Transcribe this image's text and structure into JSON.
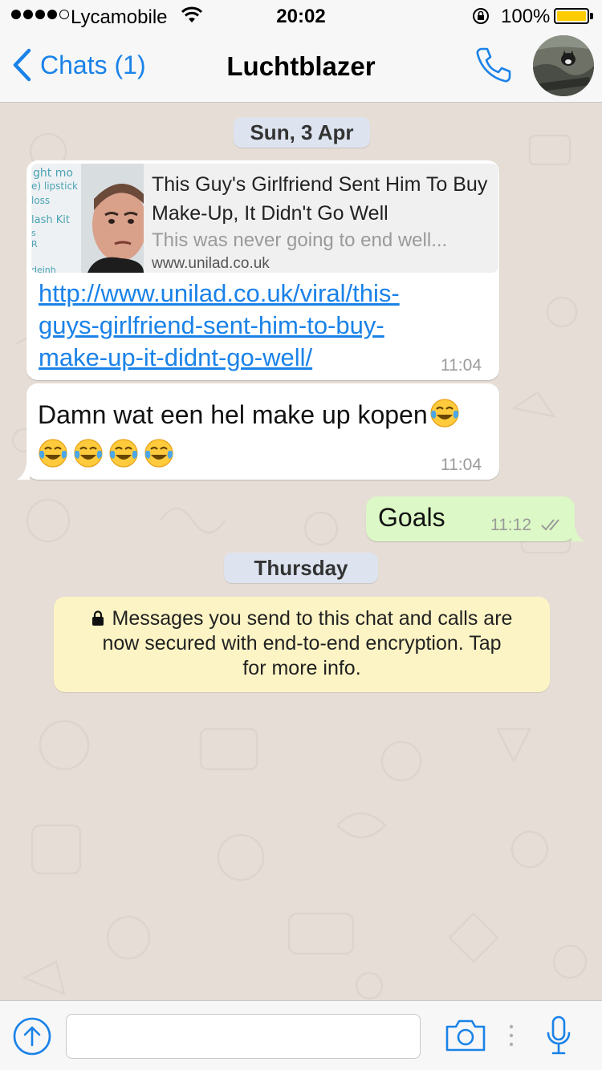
{
  "status_bar": {
    "carrier": "Lycamobile",
    "time": "20:02",
    "battery": "100%"
  },
  "nav": {
    "back_label": "Chats (1)",
    "title": "Luchtblazer"
  },
  "chat": {
    "date_1": "Sun, 3 Apr",
    "link_message": {
      "preview_title": "This Guy's Girlfriend Sent Him To Buy Make-Up, It Didn't Go Well",
      "preview_description": "This was never going to end well...",
      "preview_domain": "www.unilad.co.uk",
      "thumb_text": [
        "ght mo",
        "e) lipstick",
        "loss",
        "lash Kit",
        "s",
        "R",
        "deinh"
      ],
      "link_lines": [
        "http://www.unilad.co.uk/viral/this-",
        "guys-girlfriend-sent-him-to-buy-",
        "make-up-it-didnt-go-well/"
      ],
      "time": "11:04"
    },
    "text_message": {
      "text": "Damn wat een hel make up kopen",
      "time": "11:04"
    },
    "outgoing_message": {
      "text": "Goals",
      "time": "11:12"
    },
    "date_2": "Thursday",
    "encryption_notice": [
      "Messages you send to this chat and calls are",
      "now secured with end-to-end encryption. Tap",
      "for more info."
    ]
  },
  "colors": {
    "accent": "#1a82e8",
    "outgoing_bubble": "#dcf8c6",
    "notice_bg": "#fdf4c5",
    "chat_bg": "#e6ded6"
  },
  "input": {
    "placeholder": ""
  }
}
